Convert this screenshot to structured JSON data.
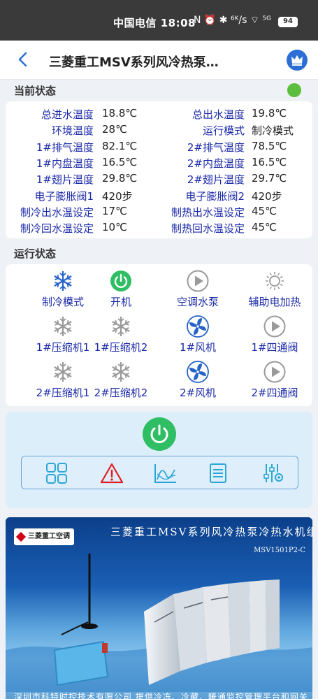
{
  "status_bar": {
    "carrier_time": "中国电信 18:08",
    "icons": "N ⏰ ✱ ⁶ᴷ/s ⌔ ⁵ᴳ",
    "battery": "94"
  },
  "appbar": {
    "title": "三菱重工MSV系列风冷热泵…"
  },
  "current_state": {
    "title": "当前状态",
    "indicator_color": "#5bbf3d",
    "rows": [
      {
        "l1": "总进水温度",
        "v1": "18.8℃",
        "l2": "总出水温度",
        "v2": "19.8℃"
      },
      {
        "l1": "环境温度",
        "v1": "28℃",
        "l2": "运行模式",
        "v2": "制冷模式"
      },
      {
        "l1": "1#排气温度",
        "v1": "82.1℃",
        "l2": "2#排气温度",
        "v2": "78.5℃"
      },
      {
        "l1": "1#内盘温度",
        "v1": "16.5℃",
        "l2": "2#内盘温度",
        "v2": "16.5℃"
      },
      {
        "l1": "1#翅片温度",
        "v1": "29.8℃",
        "l2": "2#翅片温度",
        "v2": "29.7℃"
      },
      {
        "l1": "电子膨胀阀1",
        "v1": "420步",
        "l2": "电子膨胀阀2",
        "v2": "420步"
      },
      {
        "l1": "制冷出水温设定",
        "v1": "17℃",
        "l2": "制热出水温设定",
        "v2": "45℃"
      },
      {
        "l1": "制冷回水温设定",
        "v1": "10℃",
        "l2": "制热回水温设定",
        "v2": "45℃"
      }
    ]
  },
  "run_state": {
    "title": "运行状态",
    "items": [
      {
        "label": "制冷模式",
        "icon": "snowflake-blue"
      },
      {
        "label": "开机",
        "icon": "power-green"
      },
      {
        "label": "空调水泵",
        "icon": "play-gray"
      },
      {
        "label": "辅助电加热",
        "icon": "sun-gray"
      },
      {
        "label": "1#压缩机1",
        "icon": "snowflake-gray"
      },
      {
        "label": "1#压缩机2",
        "icon": "snowflake-gray"
      },
      {
        "label": "1#风机",
        "icon": "fan-blue"
      },
      {
        "label": "1#四通阀",
        "icon": "play-gray"
      },
      {
        "label": "2#压缩机1",
        "icon": "snowflake-gray"
      },
      {
        "label": "2#压缩机2",
        "icon": "snowflake-gray"
      },
      {
        "label": "2#风机",
        "icon": "fan-blue"
      },
      {
        "label": "2#四通阀",
        "icon": "play-gray"
      }
    ]
  },
  "colors": {
    "label_blue": "#1b2aa8",
    "active_blue": "#2563c9",
    "power_green": "#2fbe64",
    "inactive_gray": "#9a9a9a",
    "alarm_red": "#e02020"
  },
  "banner": {
    "logo_text": "三菱重工空调",
    "title": "三菱重工MSV系列风冷热泵冷热水机组",
    "model": "MSV1501P2-C",
    "footer": "深圳市科特时控技术有限公司      提供冷冻、冷藏、暖通监控管理平台和网关"
  }
}
